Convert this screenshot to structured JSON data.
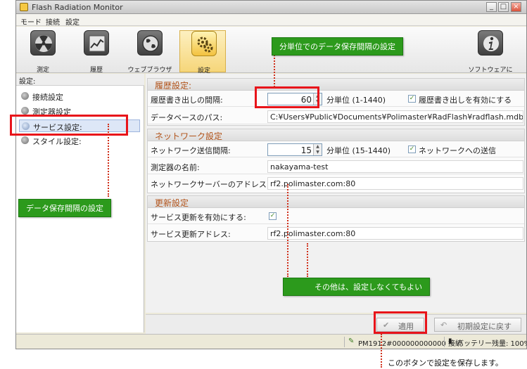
{
  "window": {
    "title": "Flash Radiation Monitor",
    "controls": [
      "_",
      "□",
      "×"
    ]
  },
  "menu": [
    "モード",
    "接続",
    "設定"
  ],
  "toolbar": [
    {
      "label": "測定",
      "icon": "radiation-icon"
    },
    {
      "label": "履歴",
      "icon": "history-chart-icon"
    },
    {
      "label": "ウェブブラウザ",
      "icon": "globe-icon"
    },
    {
      "label": "設定",
      "icon": "gears-icon",
      "active": true
    },
    {
      "label": "ソフトウェアについて",
      "icon": "info-icon"
    }
  ],
  "sidebar": {
    "header": "設定:",
    "items": [
      {
        "label": "接続設定"
      },
      {
        "label": "測定器設定"
      },
      {
        "label": "サービス設定:",
        "selected": true
      },
      {
        "label": "スタイル設定:"
      }
    ]
  },
  "history": {
    "title": "履歴設定:",
    "interval_label": "履歴書き出しの間隔:",
    "interval_value": "60",
    "interval_unit": "分単位 (1-1440)",
    "enable_label": "履歴書き出しを有効にする",
    "enable_checked": true,
    "db_path_label": "データベースのパス:",
    "db_path_value": "C:¥Users¥Public¥Documents¥Polimaster¥RadFlash¥radflash.mdb"
  },
  "network": {
    "title": "ネットワーク設定",
    "interval_label": "ネットワーク送信間隔:",
    "interval_value": "15",
    "interval_unit": "分単位 (15-1440)",
    "send_label": "ネットワークへの送信",
    "send_checked": true,
    "device_name_label": "測定器の名前:",
    "device_name_value": "nakayama-test",
    "server_label": "ネットワークサーバーのアドレス:",
    "server_value": "rf2.polimaster.com:80"
  },
  "update": {
    "title": "更新設定",
    "enable_label": "サービス更新を有効にする:",
    "enable_checked": true,
    "address_label": "サービス更新アドレス:",
    "address_value": "rf2.polimaster.com:80"
  },
  "buttons": {
    "apply": "適用",
    "reset": "初期設定に戻す"
  },
  "status": {
    "device": "PM1912#000000000000 接続",
    "battery": "バッテリー残量: 100%"
  },
  "annotations": {
    "interval_note": "分単位でのデータ保存間隔の設定",
    "sidebar_note": "データ保存間隔の設定",
    "others_note": "その他は、設定しなくてもよい",
    "save_note": "このボタンで設定を保存します。"
  },
  "colors": {
    "callout_green": "#2c9a1c",
    "highlight_red": "#e8141a",
    "group_title": "#b2531a"
  }
}
